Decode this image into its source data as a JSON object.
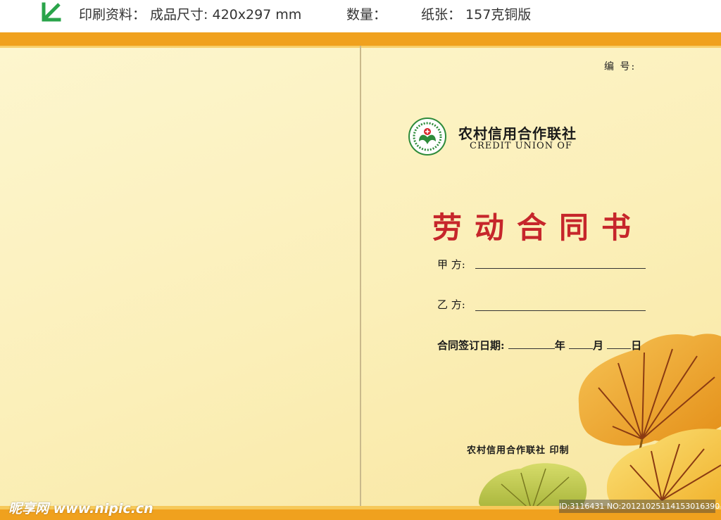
{
  "spec": {
    "arrow_icon": "green-arrow-down-left",
    "print_size_label": "印刷资料：  成品尺寸: 420x297 mm",
    "quantity_label": "数量：",
    "paper_label": "纸张： 157克铜版"
  },
  "cover": {
    "serial_label": "编 号:",
    "org_name_cn": "农村信用合作联社",
    "org_name_en": "CREDIT  UNION OF",
    "title": "劳动合同书",
    "party_a_label": "甲  方:",
    "party_b_label": "乙  方:",
    "date_prefix": "合同签订日期:",
    "date_year": "年",
    "date_month": "月",
    "date_day": "日",
    "printer_line": "农村信用合作联社 印制"
  },
  "colors": {
    "band": "#f0a11e",
    "title_red": "#c6262b",
    "logo_green": "#2e8b3a",
    "background": "#fbefb8"
  },
  "watermark": {
    "left": "昵享网 www.nipic.cn",
    "right": "ID:3116431 NO:20121025114153016390"
  }
}
